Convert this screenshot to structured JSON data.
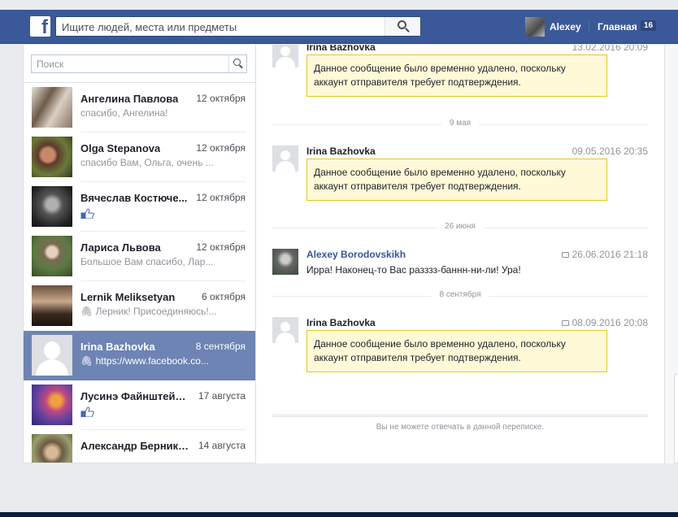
{
  "topbar": {
    "logo": "f",
    "search_placeholder": "Ищите людей, места или предметы",
    "user_name": "Alexey",
    "home_label": "Главная",
    "home_badge": "16"
  },
  "sidebar": {
    "search_placeholder": "Поиск",
    "conversations": [
      {
        "name": "Ангелина Павлова",
        "date": "12 октября",
        "snippet": "спасибо, Ангелина!",
        "selected": false
      },
      {
        "name": "Olga Stepanova",
        "date": "12 октября",
        "snippet": "спасибо Вам, Ольга, очень ...",
        "selected": false
      },
      {
        "name": "Вячеслав Костюче...",
        "date": "12 октября",
        "snippet": "",
        "selected": false,
        "like": true
      },
      {
        "name": "Лариса Львова",
        "date": "12 октября",
        "snippet": "Большое Вам спасибо, Лар...",
        "selected": false
      },
      {
        "name": "Lernik Meliksetyan",
        "date": "6 октября",
        "snippet": "Лерник! Присоединяюсь!...",
        "selected": false,
        "attach": true
      },
      {
        "name": "Irina Bazhovka",
        "date": "8 сентября",
        "snippet": "https://www.facebook.co...",
        "selected": true,
        "attach": true
      },
      {
        "name": "Лусинэ Файнштейн...",
        "date": "17 августа",
        "snippet": "",
        "selected": false,
        "like": true
      },
      {
        "name": "Александр Берников",
        "date": "14 августа",
        "snippet": "",
        "selected": false
      }
    ]
  },
  "thread": {
    "messages": [
      {
        "author": "Irina Bazhovka",
        "timestamp": "13.02.2016 20:09",
        "notice_line1": "Данное сообщение было временно удалено, поскольку",
        "notice_line2": "аккаунт отправителя требует подтверждения."
      },
      {
        "divider": "9 мая"
      },
      {
        "author": "Irina Bazhovka",
        "timestamp": "09.05.2016 20:35",
        "notice_line1": "Данное сообщение было временно удалено, поскольку",
        "notice_line2": "аккаунт отправителя требует подтверждения."
      },
      {
        "divider": "26 июня"
      },
      {
        "author": "Alexey Borodovskikh",
        "timestamp": "26.06.2016 21:18",
        "text": "Ирра!  Наконец-то Вас разззз-баннн-ни-ли! Ура!"
      },
      {
        "divider": "8 сентября"
      },
      {
        "author": "Irina Bazhovka",
        "timestamp": "08.09.2016 20:08",
        "notice_line1": "Данное сообщение было временно удалено, поскольку",
        "notice_line2": "аккаунт отправителя требует подтверждения."
      }
    ],
    "cant_reply": "Вы не можете отвечать в данной переписке."
  },
  "colors": {
    "brand": "#3b5998",
    "selected_row": "#6d84b4",
    "notice_bg": "#fff9d7",
    "notice_border": "#e2c822"
  }
}
